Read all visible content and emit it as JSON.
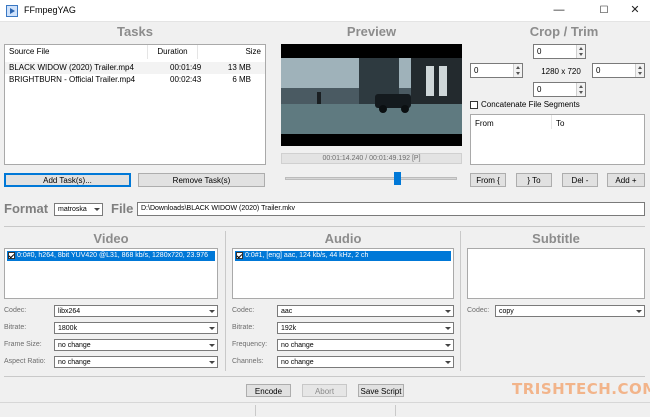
{
  "window": {
    "title": "FFmpegYAG",
    "minimize": "—",
    "maximize": "☐",
    "close": "✕"
  },
  "tasks": {
    "title": "Tasks",
    "columns": [
      "Source File",
      "Duration",
      "Size"
    ],
    "rows": [
      {
        "file": "BLACK WIDOW (2020) Trailer.mp4",
        "duration": "00:01:49",
        "size": "13 MB"
      },
      {
        "file": "BRIGHTBURN - Official Trailer.mp4",
        "duration": "00:02:43",
        "size": "6 MB"
      }
    ],
    "add_button": "Add Task(s)...",
    "remove_button": "Remove Task(s)"
  },
  "preview": {
    "title": "Preview",
    "time": "00:01:14.240 / 00:01:49.192 [P]",
    "slider_position": 0.5
  },
  "crop": {
    "title": "Crop / Trim",
    "top": "0",
    "left": "0",
    "right": "0",
    "bottom": "0",
    "resolution": "1280 x 720",
    "concatenate_label": "Concatenate File Segments",
    "col_from": "From",
    "col_to": "To",
    "from_button": "From {",
    "to_button": "} To",
    "del_button": "Del -",
    "add_button": "Add +"
  },
  "output": {
    "format_label": "Format",
    "format_value": "matroska",
    "file_label": "File",
    "file_value": "D:\\Downloads\\BLACK WIDOW (2020) Trailer.mkv"
  },
  "video": {
    "title": "Video",
    "stream": "0:0#0, h264, 8bit YUV420 @L31, 868 kb/s, 1280x720, 23.976",
    "codec_label": "Codec:",
    "codec": "libx264",
    "bitrate_label": "Bitrate:",
    "bitrate": "1800k",
    "framesize_label": "Frame Size:",
    "framesize": "no change",
    "aspect_label": "Aspect Ratio:",
    "aspect": "no change"
  },
  "audio": {
    "title": "Audio",
    "stream": "0:0#1, [eng] aac, 124 kb/s, 44 kHz, 2 ch",
    "codec_label": "Codec:",
    "codec": "aac",
    "bitrate_label": "Bitrate:",
    "bitrate": "192k",
    "frequency_label": "Frequency:",
    "frequency": "no change",
    "channels_label": "Channels:",
    "channels": "no change"
  },
  "subtitle": {
    "title": "Subtitle",
    "codec_label": "Codec:",
    "codec": "copy"
  },
  "actions": {
    "encode": "Encode",
    "abort": "Abort",
    "save_script": "Save Script"
  },
  "watermark": "TRISHTECH.COM",
  "colors": {
    "accent": "#0078d7",
    "section_title": "#8c8c8c",
    "watermark": "#f2b48a"
  }
}
